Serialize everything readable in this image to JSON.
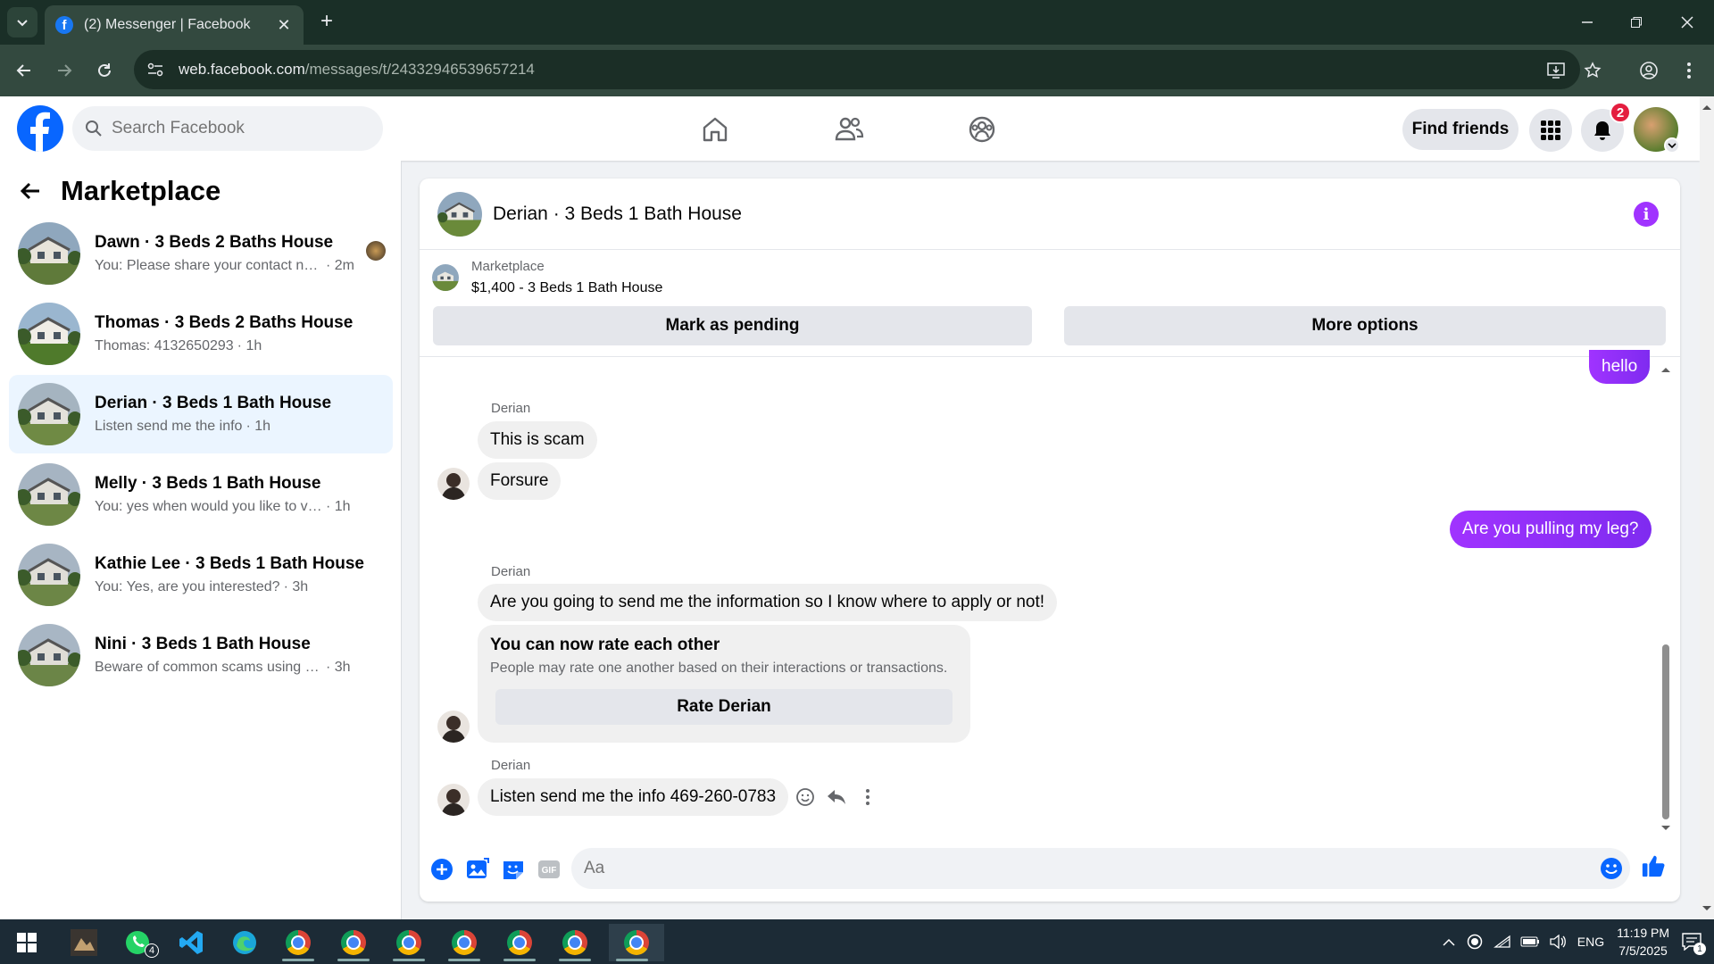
{
  "browser": {
    "tab_title": "(2) Messenger | Facebook",
    "url_host": "web.facebook.com",
    "url_path": "/messages/t/24332946539657214"
  },
  "fb": {
    "search_placeholder": "Search Facebook",
    "find_friends": "Find friends",
    "notification_count": "2"
  },
  "sidebar": {
    "title": "Marketplace",
    "conversations": [
      {
        "name": "Dawn · 3 Beds 2 Baths House",
        "snippet": "You: Please share your contact nu...",
        "time": "· 2m",
        "active": false
      },
      {
        "name": "Thomas · 3 Beds 2 Baths House",
        "snippet": "Thomas: 4132650293",
        "time": "· 1h",
        "active": false
      },
      {
        "name": "Derian · 3 Beds 1 Bath House",
        "snippet": "Listen send me the info",
        "time": "· 1h",
        "active": true
      },
      {
        "name": "Melly · 3 Beds 1 Bath House",
        "snippet": "You: yes when would you like to visit?",
        "time": "· 1h",
        "active": false
      },
      {
        "name": "Kathie Lee · 3 Beds 1 Bath House",
        "snippet": "You: Yes, are you interested?",
        "time": "· 3h",
        "active": false
      },
      {
        "name": "Nini · 3 Beds 1 Bath House",
        "snippet": "Beware of common scams using pay...",
        "time": "· 3h",
        "active": false
      }
    ]
  },
  "chat": {
    "title": "Derian · 3 Beds 1 Bath House",
    "listing_category": "Marketplace",
    "listing_price": "$1,400 - 3 Beds 1 Bath House",
    "mark_pending": "Mark as pending",
    "more_options": "More options",
    "messages": {
      "hello": "hello",
      "sender1": "Derian",
      "m1": "This is scam",
      "m2": "Forsure",
      "me2": "Are you pulling my leg?",
      "sender2": "Derian",
      "m3": "Are you going to send me the information so I know where to apply or not!",
      "rate_title": "You can now rate each other",
      "rate_sub": "People may rate one another based on their interactions or transactions.",
      "rate_button": "Rate Derian",
      "sender3": "Derian",
      "m4": "Listen send me the info 469-260-0783"
    },
    "composer_placeholder": "Aa"
  },
  "taskbar": {
    "language": "ENG",
    "time": "11:19 PM",
    "date": "7/5/2025",
    "whatsapp_badge": "4",
    "chat_badge": "1"
  },
  "colors": {
    "fb_blue": "#0866ff",
    "messenger_purple": "#a033ff",
    "active_conv": "#ebf5ff"
  }
}
